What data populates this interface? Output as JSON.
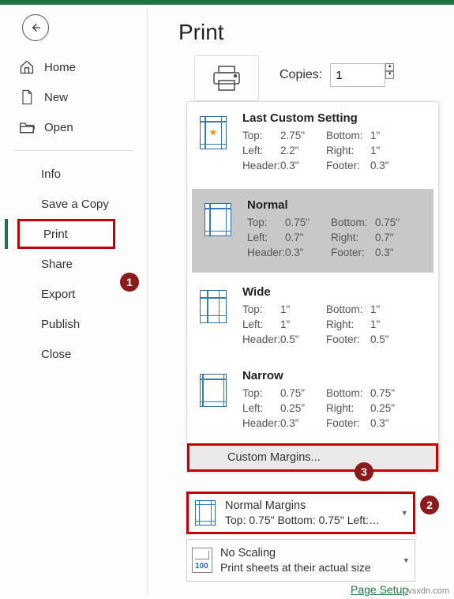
{
  "title": "Print",
  "back_icon": "back",
  "sidebar": {
    "home": "Home",
    "new": "New",
    "open": "Open",
    "info": "Info",
    "save_copy": "Save a Copy",
    "print": "Print",
    "share": "Share",
    "export": "Export",
    "publish": "Publish",
    "close": "Close"
  },
  "copies": {
    "label": "Copies:",
    "value": "1"
  },
  "margins_dropdown": {
    "options": [
      {
        "title": "Last Custom Setting",
        "icon": "star",
        "top": "2.75\"",
        "bottom": "1\"",
        "left": "2.2\"",
        "right": "1\"",
        "header": "0.3\"",
        "footer": "0.3\""
      },
      {
        "title": "Normal",
        "icon": "normal",
        "selected": true,
        "top": "0.75\"",
        "bottom": "0.75\"",
        "left": "0.7\"",
        "right": "0.7\"",
        "header": "0.3\"",
        "footer": "0.3\""
      },
      {
        "title": "Wide",
        "icon": "wide",
        "top": "1\"",
        "bottom": "1\"",
        "left": "1\"",
        "right": "1\"",
        "header": "0.5\"",
        "footer": "0.5\""
      },
      {
        "title": "Narrow",
        "icon": "narrow",
        "top": "0.75\"",
        "bottom": "0.75\"",
        "left": "0.25\"",
        "right": "0.25\"",
        "header": "0.3\"",
        "footer": "0.3\""
      }
    ],
    "custom": "Custom Margins..."
  },
  "labels": {
    "top": "Top:",
    "bottom": "Bottom:",
    "left": "Left:",
    "right": "Right:",
    "header": "Header:",
    "footer": "Footer:"
  },
  "selected_margins": {
    "line1": "Normal Margins",
    "line2": "Top: 0.75\" Bottom: 0.75\" Left:…"
  },
  "scaling": {
    "num": "100",
    "line1": "No Scaling",
    "line2": "Print sheets at their actual size"
  },
  "page_setup": "Page Setup",
  "footer_text": "vsxdn.com",
  "callouts": {
    "c1": "1",
    "c2": "2",
    "c3": "3"
  }
}
